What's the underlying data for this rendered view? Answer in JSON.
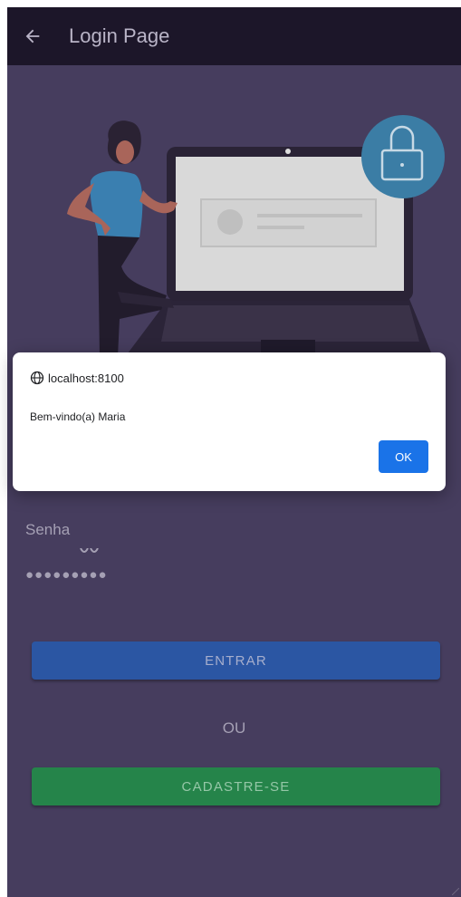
{
  "toolbar": {
    "back_icon": "arrow-left-icon",
    "title": "Login Page"
  },
  "form": {
    "password_label": "Senha",
    "password_value": "●●●●●●●●●",
    "login_button": "ENTRAR",
    "or_text": "OU",
    "signup_button": "CADASTRE-SE"
  },
  "alert": {
    "origin": "localhost:8100",
    "origin_icon": "globe-icon",
    "message": "Bem-vindo(a) Maria",
    "ok_label": "OK"
  },
  "colors": {
    "toolbar_bg": "#1c1629",
    "content_bg": "#463d5e",
    "login_button": "#2b56a3",
    "signup_button": "#25844a",
    "dialog_accent": "#1a73e8"
  }
}
